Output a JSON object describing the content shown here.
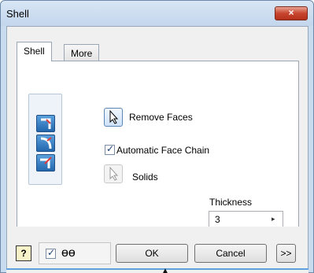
{
  "window": {
    "title": "Shell",
    "close_glyph": "×"
  },
  "tabs": [
    {
      "label": "Shell",
      "active": true
    },
    {
      "label": "More",
      "active": false
    }
  ],
  "face_buttons": [
    {
      "icon": "shell-inside-icon"
    },
    {
      "icon": "shell-outside-icon"
    },
    {
      "icon": "shell-both-icon"
    }
  ],
  "remove_faces": {
    "label": "Remove Faces",
    "icon": "cursor-arrow-icon"
  },
  "automatic_face_chain": {
    "label": "Automatic Face Chain",
    "checked": true,
    "check_glyph": "✓"
  },
  "solids": {
    "label": "Solids",
    "icon": "cursor-arrow-icon"
  },
  "thickness": {
    "label": "Thickness",
    "value": "3",
    "spin_glyph": "▸"
  },
  "footer": {
    "help_glyph": "?",
    "preview": {
      "checked": true,
      "check_glyph": "✓",
      "icon": "glasses-icon",
      "icon_glyph": "ɵɵ"
    },
    "ok_label": "OK",
    "cancel_label": "Cancel",
    "more_label": ">>",
    "expander_glyph": "▲"
  },
  "colors": {
    "accent": "#5ea2dd",
    "titlebar": "#c9dbee",
    "close": "#c7452e"
  }
}
